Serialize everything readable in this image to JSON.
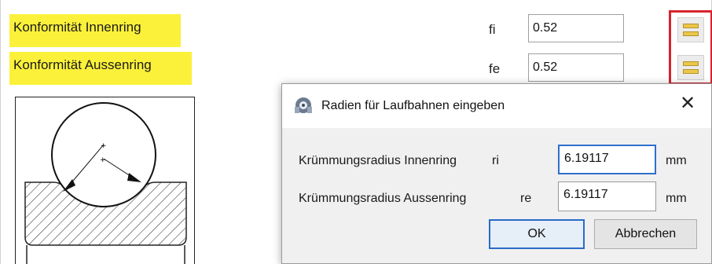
{
  "params": {
    "inner_conformity": {
      "label": "Konformität Innenring",
      "symbol": "fi",
      "value": "0.52"
    },
    "outer_conformity": {
      "label": "Konformität Aussenring",
      "symbol": "fe",
      "value": "0.52"
    }
  },
  "colors": {
    "highlight": "#fbf13a",
    "red_outline": "#d7232d",
    "focus_blue": "#2f6fca",
    "dialog_bg": "#f0f0f0"
  },
  "icons": {
    "row_button": "list-bars-icon",
    "dialog_title": "app-icon",
    "close": "close-icon"
  },
  "dialog": {
    "title": "Radien für Laufbahnen eingeben",
    "close_glyph": "✕",
    "inner_radius": {
      "label": "Krümmungsradius Innenring",
      "symbol": "ri",
      "value": "6.19117",
      "unit": "mm"
    },
    "outer_radius": {
      "label": "Krümmungsradius Aussenring",
      "symbol": "re",
      "value": "6.19117",
      "unit": "mm"
    },
    "ok_label": "OK",
    "cancel_label": "Abbrechen"
  }
}
